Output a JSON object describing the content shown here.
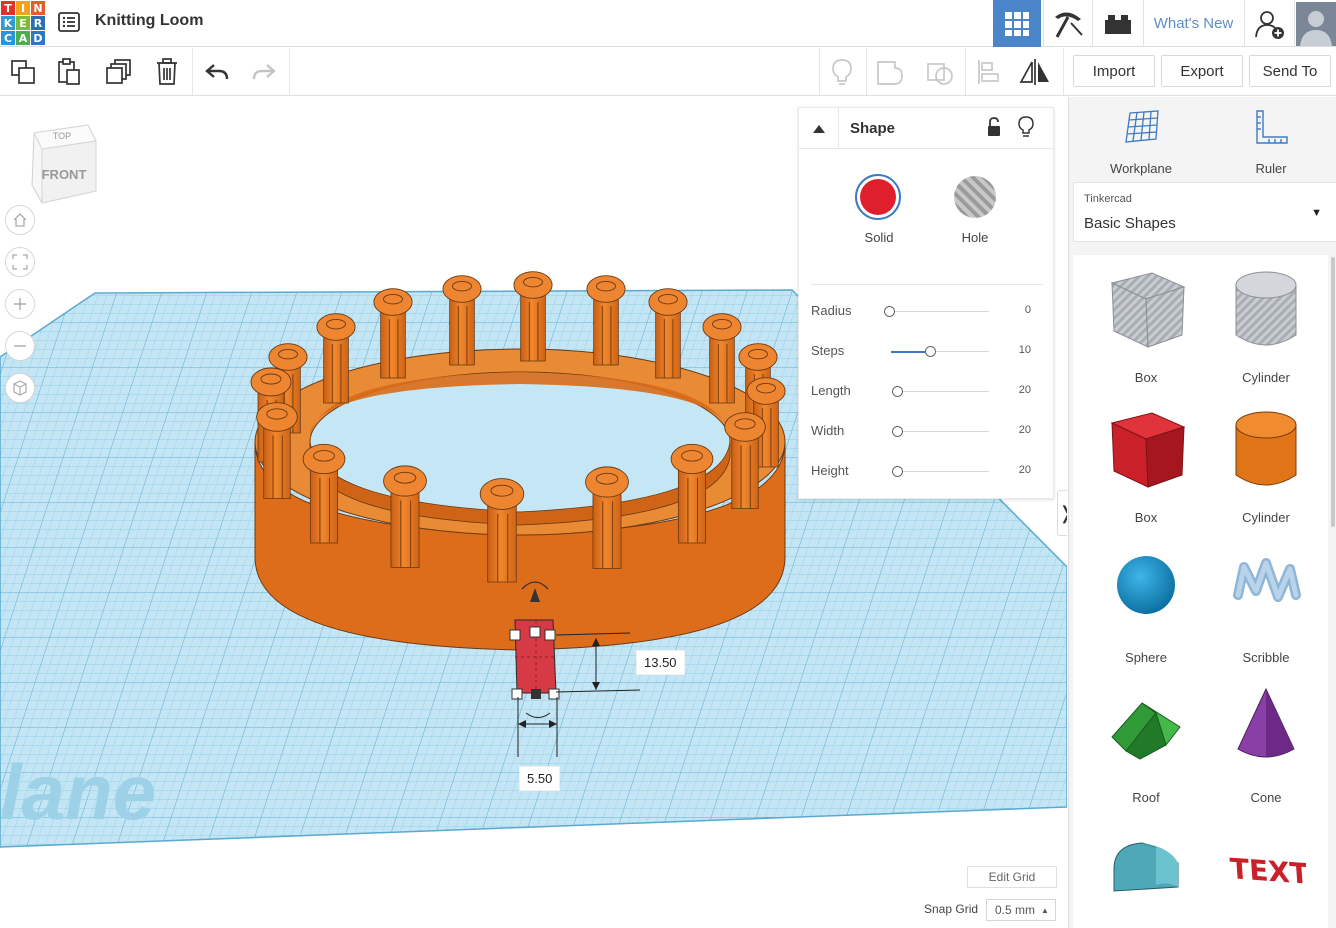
{
  "app": {
    "logo_letters": [
      "T",
      "I",
      "N",
      "K",
      "E",
      "R",
      "C",
      "A",
      "D"
    ],
    "document_title": "Knitting Loom",
    "whats_new_label": "What's New"
  },
  "toolbar": {
    "import_label": "Import",
    "export_label": "Export",
    "send_to_label": "Send To"
  },
  "viewport": {
    "viewcube_top": "TOP",
    "viewcube_front": "FRONT",
    "workplane_watermark": "lane",
    "dimension_height": "13.50",
    "dimension_width": "5.50",
    "edit_grid_label": "Edit Grid",
    "snap_grid_label": "Snap Grid",
    "snap_grid_value": "0.5 mm"
  },
  "inspector": {
    "title": "Shape",
    "solid_label": "Solid",
    "hole_label": "Hole",
    "solid_color": "#e01f2d",
    "params": [
      {
        "label": "Radius",
        "value": "0"
      },
      {
        "label": "Steps",
        "value": "10"
      },
      {
        "label": "Length",
        "value": "20"
      },
      {
        "label": "Width",
        "value": "20"
      },
      {
        "label": "Height",
        "value": "20"
      }
    ],
    "toggle_glyph": "❭"
  },
  "sidebar": {
    "workplane_label": "Workplane",
    "ruler_label": "Ruler",
    "library_source": "Tinkercad",
    "library_name": "Basic Shapes",
    "shapes": [
      {
        "label": "Box"
      },
      {
        "label": "Cylinder"
      },
      {
        "label": "Box"
      },
      {
        "label": "Cylinder"
      },
      {
        "label": "Sphere"
      },
      {
        "label": "Scribble"
      },
      {
        "label": "Roof"
      },
      {
        "label": "Cone"
      },
      {
        "label": ""
      },
      {
        "label": ""
      }
    ],
    "text_shape_glyphs": "TEXT"
  },
  "colors": {
    "accent": "#4a84c9",
    "loom_orange": "#e8741d",
    "grid_blue": "#bfe4f3",
    "selected_red": "#d63a44"
  }
}
